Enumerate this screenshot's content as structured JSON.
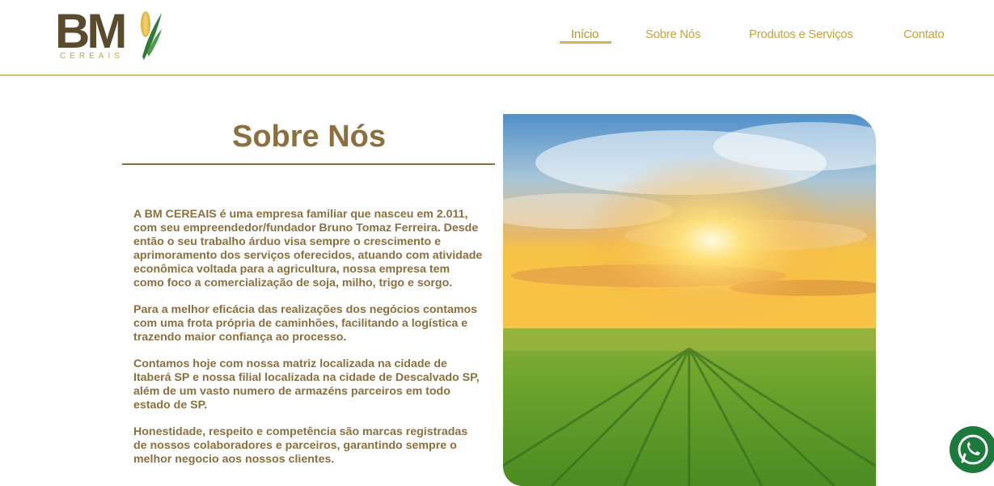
{
  "brand": {
    "logo_text": "BM",
    "logo_sub": "CEREAIS"
  },
  "nav": {
    "items": [
      {
        "label": "Início",
        "active": true
      },
      {
        "label": "Sobre Nós",
        "active": false
      },
      {
        "label": "Produtos e Serviços",
        "active": false
      },
      {
        "label": "Contato",
        "active": false
      }
    ]
  },
  "about": {
    "title": "Sobre Nós",
    "paragraphs": [
      "A BM CEREAIS é uma empresa familiar que nasceu em 2.011, com seu empreendedor/fundador Bruno Tomaz Ferreira. Desde então o seu trabalho árduo visa sempre o crescimento e aprimoramento dos serviços oferecidos, atuando com atividade econômica voltada para a agricultura, nossa empresa tem como foco a comercialização de soja, milho, trigo e sorgo.",
      "Para a melhor eficácia das realizações dos negócios contamos com uma frota própria de caminhões, facilitando a logística e trazendo maior confiança ao processo.",
      "Contamos hoje com nossa matriz localizada na cidade de Itaberá SP e nossa filial localizada na cidade de Descalvado SP, além de um vasto numero de armazéns parceiros em todo estado de SP.",
      "Honestidade, respeito e competência são marcas registradas de nossos colaboradores e parceiros, garantindo sempre o melhor negocio aos nossos clientes."
    ]
  },
  "colors": {
    "brand_gold": "#c9a43a",
    "brand_brown": "#8c6f3e",
    "whatsapp_green": "#1c7a3c"
  },
  "icons": {
    "whatsapp": "whatsapp-icon"
  }
}
